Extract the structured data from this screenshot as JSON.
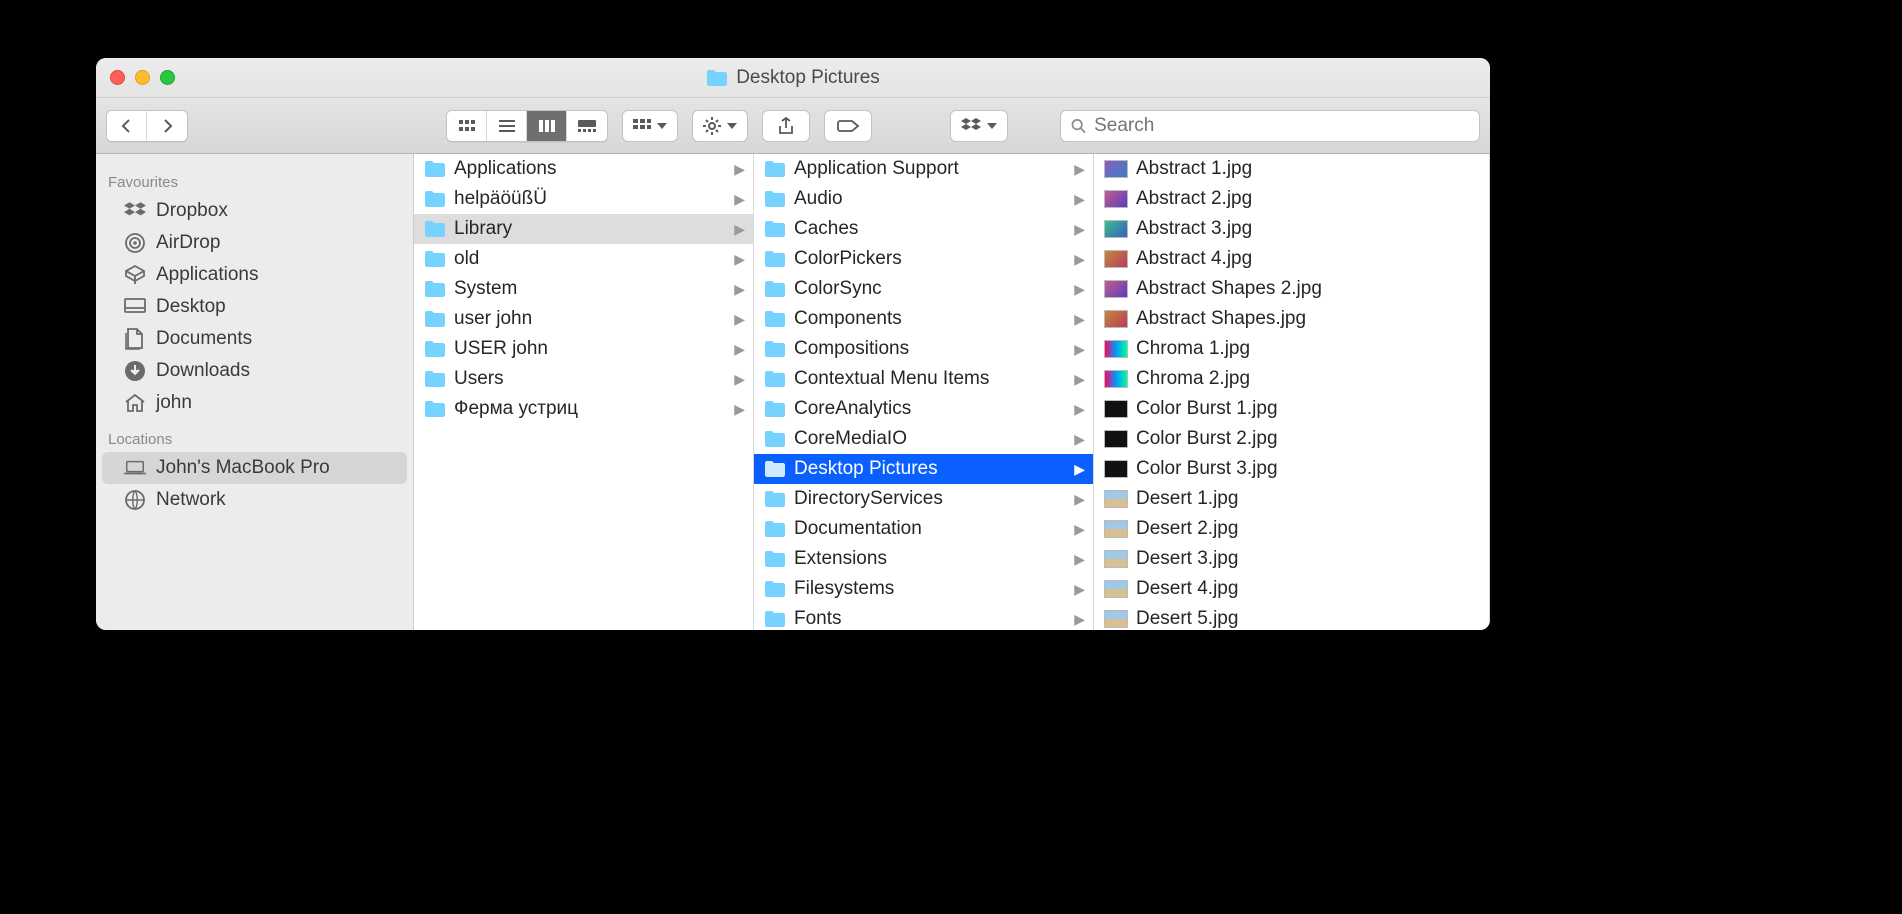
{
  "window": {
    "title": "Desktop Pictures"
  },
  "search": {
    "placeholder": "Search"
  },
  "sidebar": {
    "sections": [
      {
        "header": "Favourites",
        "items": [
          {
            "icon": "dropbox",
            "label": "Dropbox"
          },
          {
            "icon": "airdrop",
            "label": "AirDrop"
          },
          {
            "icon": "applications",
            "label": "Applications"
          },
          {
            "icon": "desktop",
            "label": "Desktop"
          },
          {
            "icon": "documents",
            "label": "Documents"
          },
          {
            "icon": "downloads",
            "label": "Downloads"
          },
          {
            "icon": "home",
            "label": "john"
          }
        ]
      },
      {
        "header": "Locations",
        "items": [
          {
            "icon": "laptop",
            "label": "John's MacBook Pro",
            "selected": true
          },
          {
            "icon": "network",
            "label": "Network"
          }
        ]
      }
    ]
  },
  "columns": [
    {
      "items": [
        {
          "type": "folder",
          "label": "Applications",
          "arrow": true
        },
        {
          "type": "folder",
          "label": "helpäöüßÜ",
          "arrow": true
        },
        {
          "type": "folder",
          "label": "Library",
          "arrow": true,
          "pathSelected": true
        },
        {
          "type": "folder",
          "label": "old",
          "arrow": true
        },
        {
          "type": "folder",
          "label": "System",
          "arrow": true
        },
        {
          "type": "folder",
          "label": "user john",
          "arrow": true
        },
        {
          "type": "folder",
          "label": "USER john",
          "arrow": true
        },
        {
          "type": "folder",
          "label": "Users",
          "arrow": true
        },
        {
          "type": "folder",
          "label": "Ферма устриц",
          "arrow": true
        }
      ]
    },
    {
      "items": [
        {
          "type": "folder",
          "label": "Application Support",
          "arrow": true
        },
        {
          "type": "folder",
          "label": "Audio",
          "arrow": true
        },
        {
          "type": "folder",
          "label": "Caches",
          "arrow": true
        },
        {
          "type": "folder",
          "label": "ColorPickers",
          "arrow": true
        },
        {
          "type": "folder",
          "label": "ColorSync",
          "arrow": true
        },
        {
          "type": "folder",
          "label": "Components",
          "arrow": true
        },
        {
          "type": "folder",
          "label": "Compositions",
          "arrow": true
        },
        {
          "type": "folder",
          "label": "Contextual Menu Items",
          "arrow": true
        },
        {
          "type": "folder",
          "label": "CoreAnalytics",
          "arrow": true
        },
        {
          "type": "folder",
          "label": "CoreMediaIO",
          "arrow": true
        },
        {
          "type": "folder",
          "label": "Desktop Pictures",
          "arrow": true,
          "activeSelected": true
        },
        {
          "type": "folder",
          "label": "DirectoryServices",
          "arrow": true
        },
        {
          "type": "folder",
          "label": "Documentation",
          "arrow": true
        },
        {
          "type": "folder",
          "label": "Extensions",
          "arrow": true
        },
        {
          "type": "folder",
          "label": "Filesystems",
          "arrow": true
        },
        {
          "type": "folder",
          "label": "Fonts",
          "arrow": true
        }
      ]
    },
    {
      "items": [
        {
          "type": "image",
          "label": "Abstract 1.jpg",
          "thumb": "v1"
        },
        {
          "type": "image",
          "label": "Abstract 2.jpg",
          "thumb": "v2"
        },
        {
          "type": "image",
          "label": "Abstract 3.jpg",
          "thumb": "v3"
        },
        {
          "type": "image",
          "label": "Abstract 4.jpg",
          "thumb": "v4"
        },
        {
          "type": "image",
          "label": "Abstract Shapes 2.jpg",
          "thumb": "v2"
        },
        {
          "type": "image",
          "label": "Abstract Shapes.jpg",
          "thumb": "v4"
        },
        {
          "type": "image",
          "label": "Chroma 1.jpg",
          "thumb": "v5"
        },
        {
          "type": "image",
          "label": "Chroma 2.jpg",
          "thumb": "v5"
        },
        {
          "type": "image",
          "label": "Color Burst 1.jpg",
          "thumb": "v6"
        },
        {
          "type": "image",
          "label": "Color Burst 2.jpg",
          "thumb": "v6"
        },
        {
          "type": "image",
          "label": "Color Burst 3.jpg",
          "thumb": "v6"
        },
        {
          "type": "image",
          "label": "Desert 1.jpg",
          "thumb": "desert"
        },
        {
          "type": "image",
          "label": "Desert 2.jpg",
          "thumb": "desert"
        },
        {
          "type": "image",
          "label": "Desert 3.jpg",
          "thumb": "desert"
        },
        {
          "type": "image",
          "label": "Desert 4.jpg",
          "thumb": "desert"
        },
        {
          "type": "image",
          "label": "Desert 5.jpg",
          "thumb": "desert"
        }
      ]
    }
  ]
}
